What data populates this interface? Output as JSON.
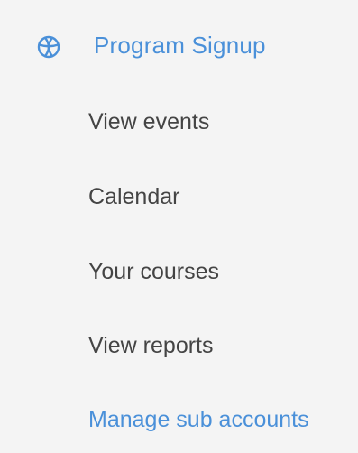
{
  "section": {
    "icon": "basketball-icon",
    "title": "Program Signup"
  },
  "nav": {
    "items": [
      {
        "label": "View events",
        "active": false
      },
      {
        "label": "Calendar",
        "active": false
      },
      {
        "label": "Your courses",
        "active": false
      },
      {
        "label": "View reports",
        "active": false
      },
      {
        "label": "Manage sub accounts",
        "active": true
      }
    ]
  },
  "colors": {
    "accent": "#4a90d9",
    "text": "#444444",
    "background": "#f4f4f4"
  }
}
